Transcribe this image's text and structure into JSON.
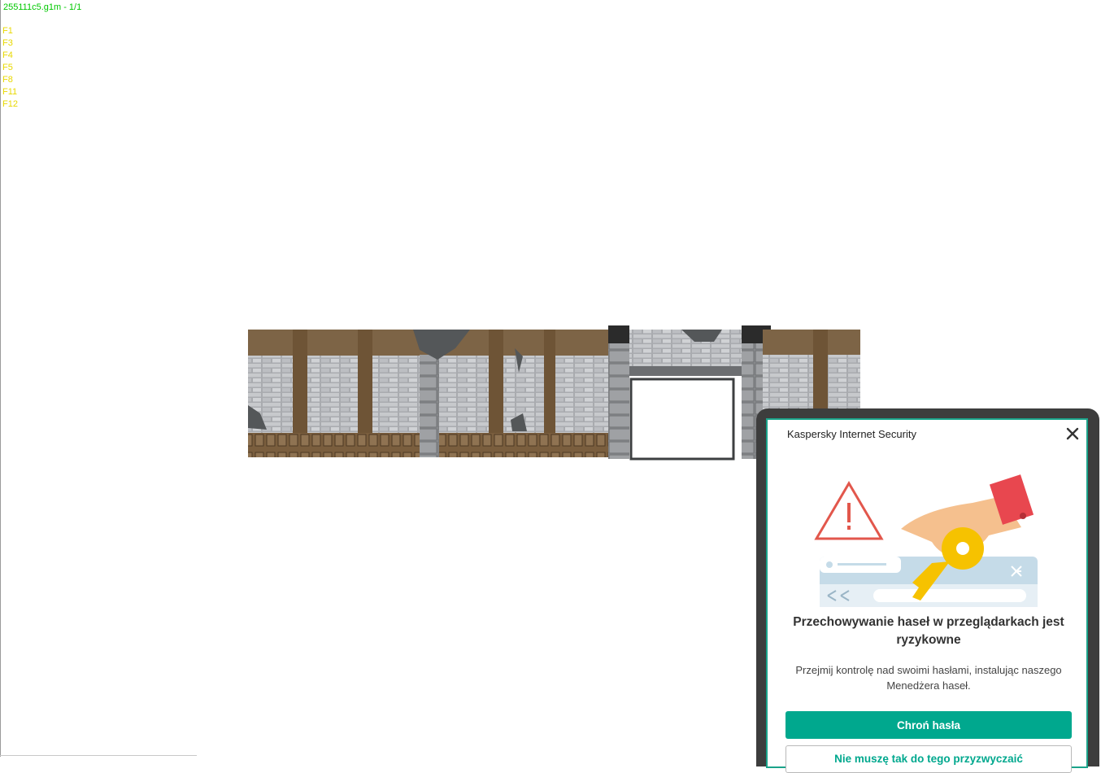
{
  "viewer": {
    "file_label": "255111c5.g1m - 1/1",
    "function_keys": [
      "F1",
      "F3",
      "F4",
      "F5",
      "F8",
      "F11",
      "F12"
    ]
  },
  "colors": {
    "hud_title": "#00c800",
    "hud_keys": "#e8d800",
    "kaspersky_green": "#00a88e"
  },
  "popup": {
    "app_name": "Kaspersky Internet Security",
    "close_icon": "close-icon",
    "headline": "Przechowywanie haseł w przeglądarkach jest ryzykowne",
    "description": "Przejmij kontrolę nad swoimi hasłami, instalując naszego Menedżera haseł.",
    "primary_button": "Chroń hasła",
    "secondary_button": "Nie muszę tak do tego przyzwyczaić"
  }
}
